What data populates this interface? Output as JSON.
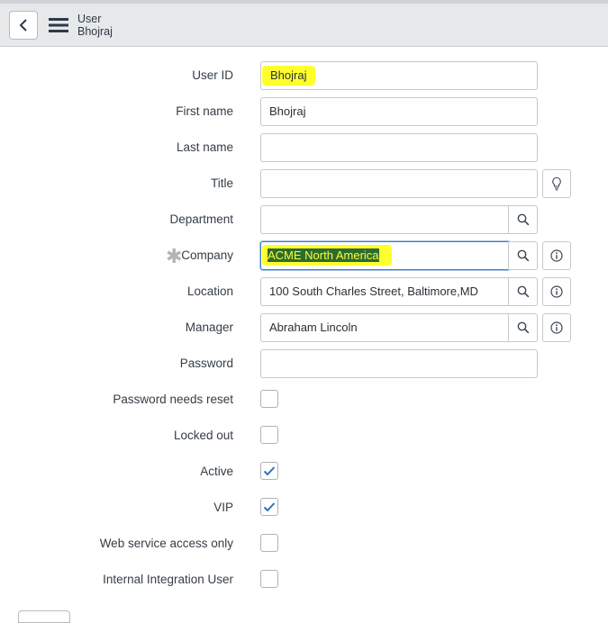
{
  "header": {
    "title": "User",
    "record": "Bhojraj"
  },
  "form": {
    "user_id": {
      "label": "User ID",
      "value": "Bhojraj"
    },
    "first_name": {
      "label": "First name",
      "value": "Bhojraj"
    },
    "last_name": {
      "label": "Last name",
      "value": ""
    },
    "title": {
      "label": "Title",
      "value": ""
    },
    "department": {
      "label": "Department",
      "value": ""
    },
    "company": {
      "label": "Company",
      "value": "ACME North America",
      "required_marker": "✱"
    },
    "location": {
      "label": "Location",
      "value": "100 South Charles Street, Baltimore,MD"
    },
    "manager": {
      "label": "Manager",
      "value": "Abraham Lincoln"
    },
    "password": {
      "label": "Password",
      "value": ""
    },
    "password_needs_reset": {
      "label": "Password needs reset",
      "checked": false
    },
    "locked_out": {
      "label": "Locked out",
      "checked": false
    },
    "active": {
      "label": "Active",
      "checked": true
    },
    "vip": {
      "label": "VIP",
      "checked": true
    },
    "web_service_access_only": {
      "label": "Web service access only",
      "checked": false
    },
    "internal_integration_user": {
      "label": "Internal Integration User",
      "checked": false
    }
  },
  "icons": {
    "back": "chevron-left-icon",
    "menu": "hamburger-menu-icon",
    "search": "magnifier-icon",
    "info": "info-icon",
    "suggestion": "lightbulb-icon",
    "check": "checkmark-icon"
  },
  "colors": {
    "header_bg": "#e6e8ea",
    "highlight": "#ffff2e",
    "selection": "#2d6b33",
    "focus_border": "#3d7ac8",
    "check": "#2f6fc2"
  }
}
